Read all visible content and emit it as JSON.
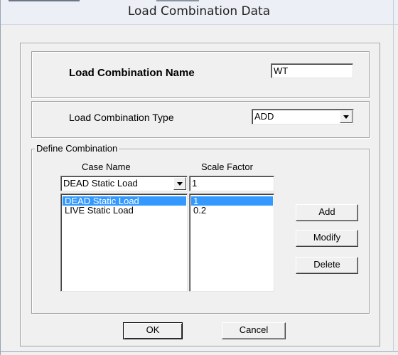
{
  "window": {
    "title": "Load Combination Data"
  },
  "combination_name": {
    "label": "Load Combination Name",
    "value": "WT"
  },
  "combination_type": {
    "label": "Load Combination Type",
    "value": "ADD"
  },
  "define": {
    "legend": "Define Combination",
    "case_header": "Case Name",
    "scale_header": "Scale Factor",
    "case_selected": "DEAD Static Load",
    "scale_value": "1",
    "rows": [
      {
        "case": "DEAD Static Load",
        "scale": "1",
        "selected": true
      },
      {
        "case": "LIVE Static Load",
        "scale": "0.2",
        "selected": false
      }
    ]
  },
  "buttons": {
    "add": "Add",
    "modify": "Modify",
    "delete": "Delete",
    "ok": "OK",
    "cancel": "Cancel"
  },
  "icons": {
    "dropdown": "chevron-down-icon"
  },
  "colors": {
    "selection": "#3399ff",
    "dialog_bg": "#f0f0f0",
    "titlebar_bg": "#eceff5"
  }
}
